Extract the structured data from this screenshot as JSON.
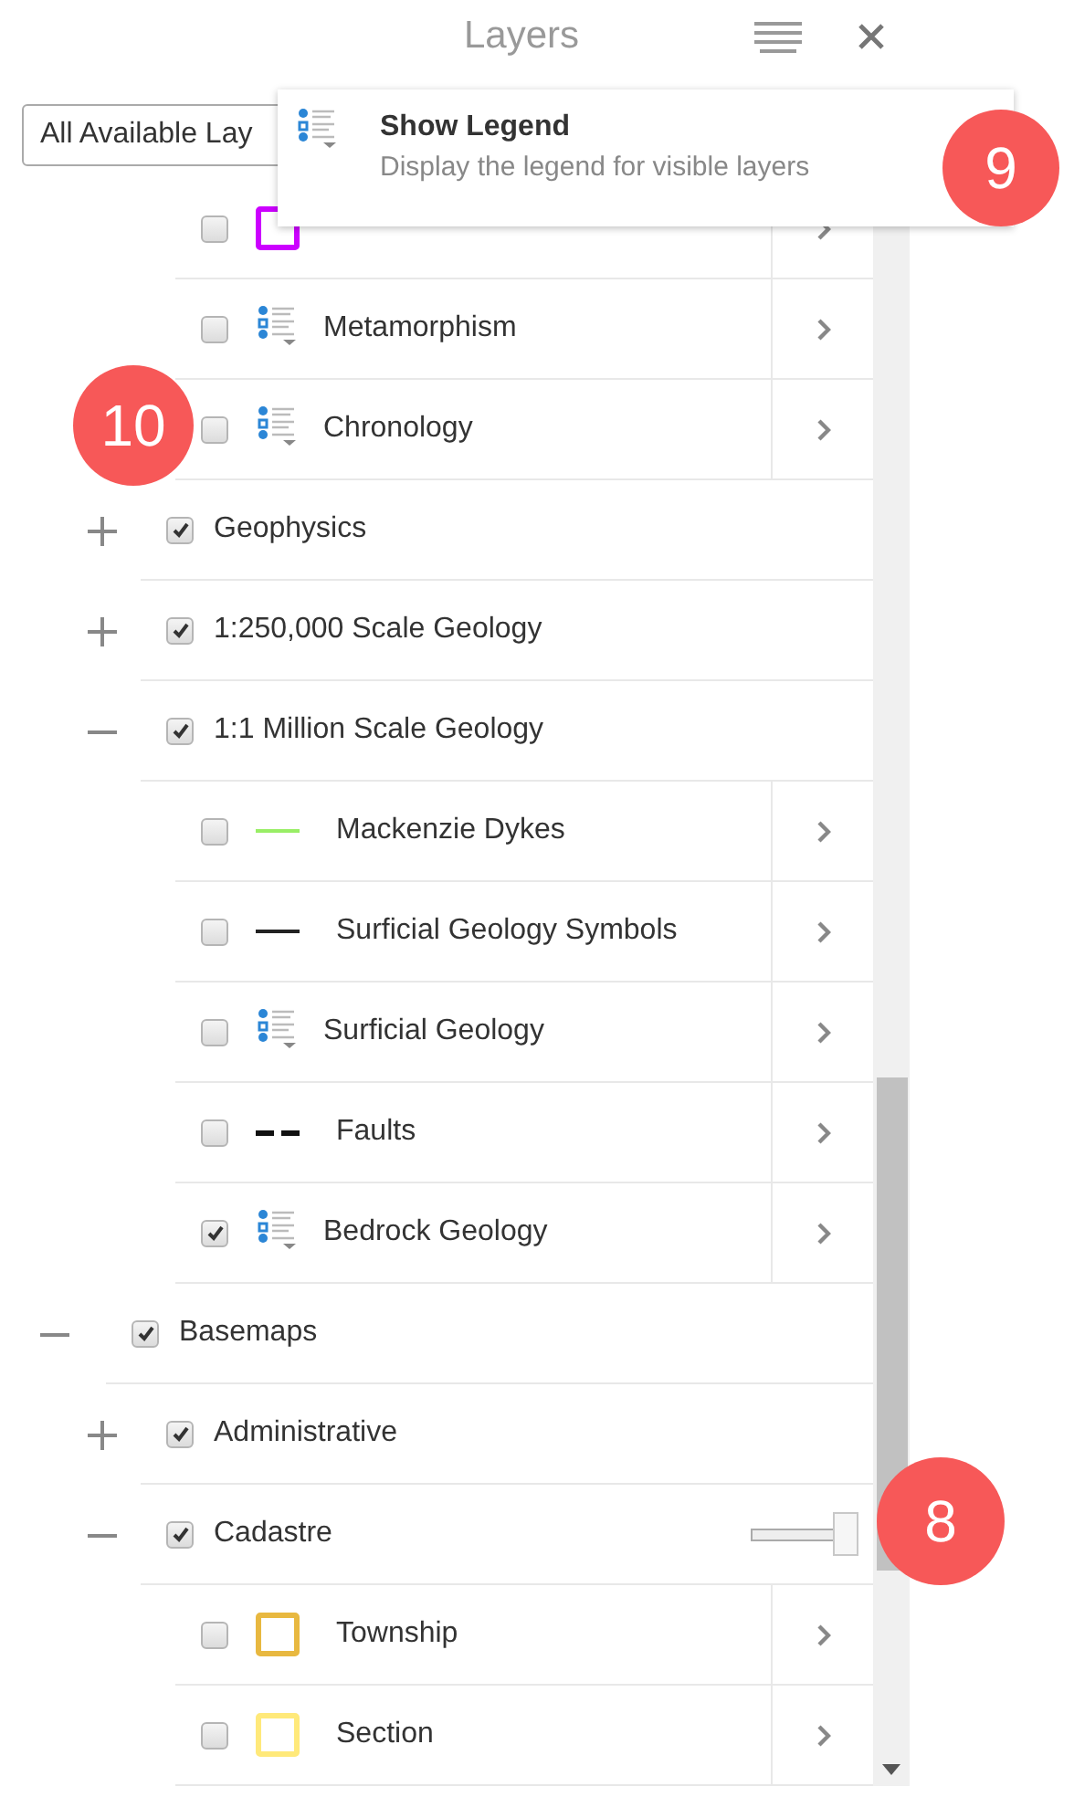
{
  "panel": {
    "title": "Layers"
  },
  "filter": {
    "value": "All Available Lay"
  },
  "tooltip": {
    "title": "Show Legend",
    "description": "Display the legend for visible layers"
  },
  "layers": [
    {
      "children": [
        {
          "children": [
            {
              "checked": false,
              "kind": "square",
              "color": "#cc00ff"
            },
            {
              "label": "Metamorphism",
              "checked": false,
              "kind": "legend"
            },
            {
              "label": "Chronology",
              "checked": false,
              "kind": "legend"
            }
          ]
        },
        {
          "label": "Geophysics",
          "checked": true,
          "expanded": false
        },
        {
          "label": "1:250,000 Scale Geology",
          "checked": true,
          "expanded": false
        },
        {
          "label": "1:1 Million Scale Geology",
          "checked": true,
          "expanded": true,
          "children": [
            {
              "label": "Mackenzie Dykes",
              "checked": false,
              "kind": "line",
              "color": "#99ee66"
            },
            {
              "label": "Surficial Geology Symbols",
              "checked": false,
              "kind": "line",
              "color": "#222222"
            },
            {
              "label": "Surficial Geology",
              "checked": false,
              "kind": "legend"
            },
            {
              "label": "Faults",
              "checked": false,
              "kind": "dashed",
              "color": "#111111"
            },
            {
              "label": "Bedrock Geology",
              "checked": true,
              "kind": "legend"
            }
          ]
        }
      ]
    },
    {
      "label": "Basemaps",
      "checked": true,
      "expanded": true,
      "children": [
        {
          "label": "Administrative",
          "checked": true,
          "expanded": false
        },
        {
          "label": "Cadastre",
          "checked": true,
          "expanded": true,
          "opacity": {
            "level": 1
          },
          "children": [
            {
              "label": "Township",
              "checked": false,
              "kind": "square",
              "color": "#e8b840"
            },
            {
              "label": "Section",
              "checked": false,
              "kind": "square",
              "color": "#ffe97a"
            }
          ]
        }
      ]
    }
  ],
  "callouts": [
    {
      "number": "9"
    },
    {
      "number": "10"
    },
    {
      "number": "8"
    }
  ]
}
